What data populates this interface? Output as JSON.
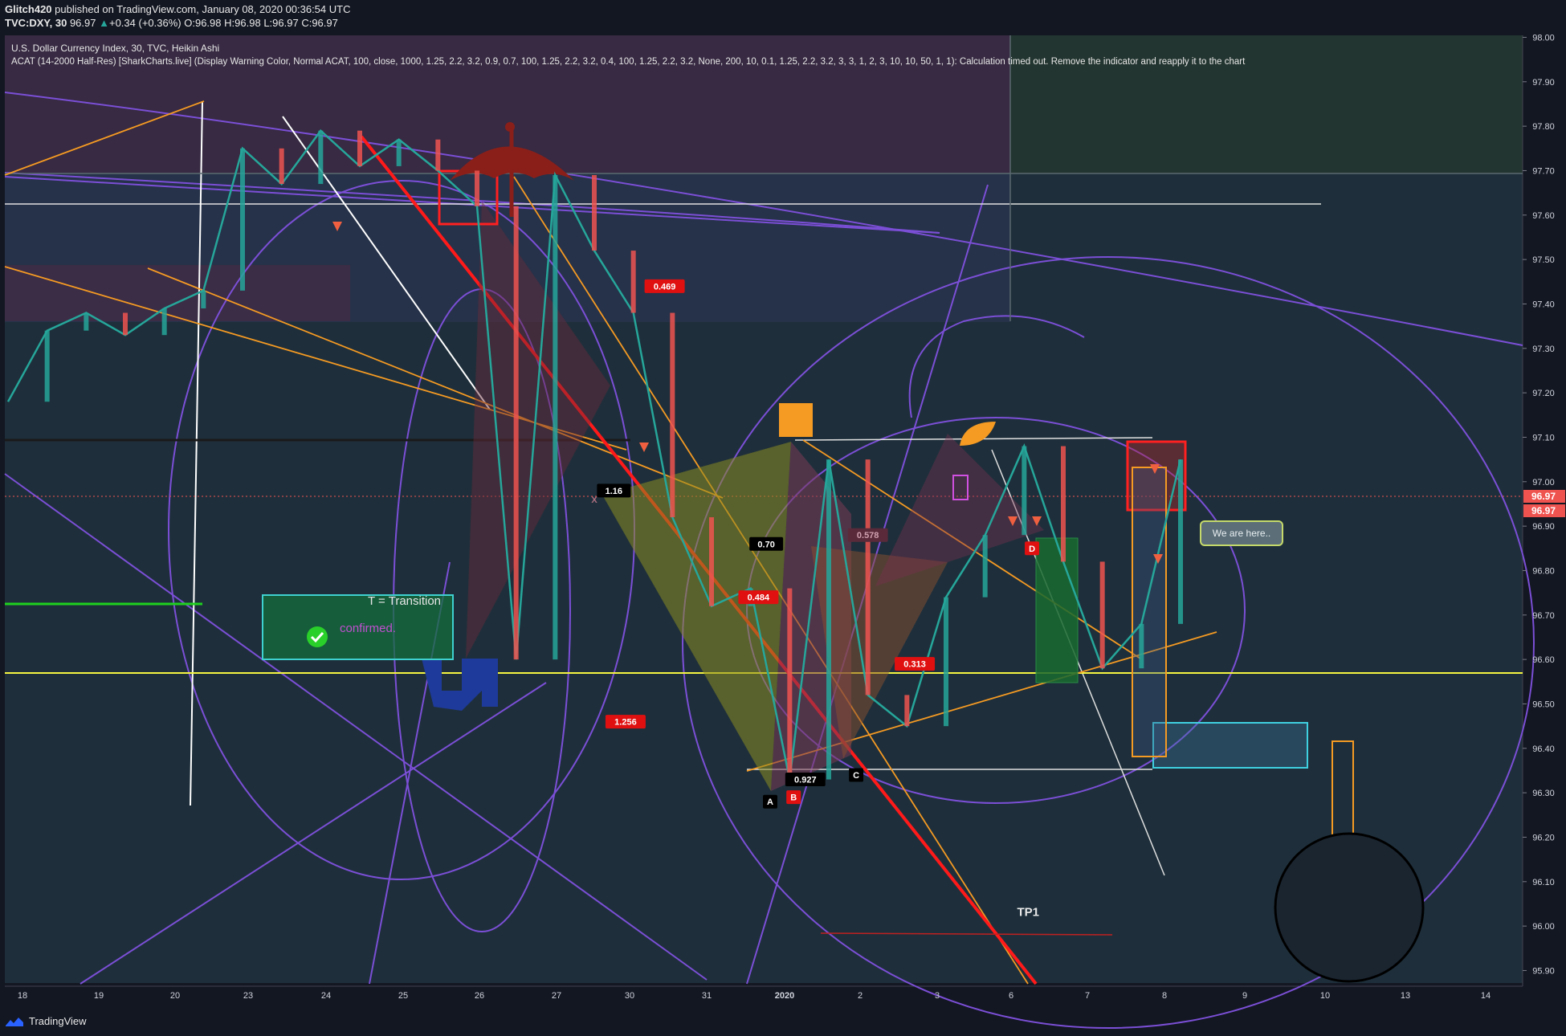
{
  "header": {
    "publisher": "Glitch420",
    "publish_text": " published on TradingView.com, January 08, 2020 00:36:54 UTC",
    "symbol": "TVC:DXY, 30",
    "last": "96.97",
    "change": "+0.34 (+0.36%)",
    "o_label": "O:",
    "o_value": "96.98",
    "h_label": "H:",
    "h_value": "96.98",
    "l_label": "L:",
    "l_value": "96.97",
    "c_label": "C:",
    "c_value": "96.97"
  },
  "legend": {
    "line1": "U.S. Dollar Currency Index, 30, TVC, Heikin Ashi",
    "line2": "ACAT (14-2000 Half-Res) [SharkCharts.live] (Display Warning Color, Normal ACAT, 100, close, 1000, 1.25, 2.2, 3.2, 0.9, 0.7, 100, 1.25, 2.2, 3.2, 0.4, 100, 1.25, 2.2, 3.2, None, 200, 10, 0.1, 1.25, 2.2, 3.2, 3, 3, 1, 2, 3, 10, 10, 50, 1, 1): Calculation timed out. Remove the indicator and reapply it to the chart"
  },
  "colors": {
    "background": "#131722",
    "candle_up": "#26a69a",
    "candle_down": "#ef5350",
    "price_tag": "#ef5350",
    "yellow_line": "#f5f541",
    "purple": "#7b4fd6",
    "orange": "#f59a23"
  },
  "chart_data": {
    "type": "line",
    "title": "U.S. Dollar Currency Index, 30, TVC, Heikin Ashi",
    "y_axis_labels": [
      "98.00",
      "97.90",
      "97.80",
      "97.70",
      "97.60",
      "97.50",
      "97.40",
      "97.30",
      "97.20",
      "97.10",
      "97.00",
      "96.90",
      "96.80",
      "96.70",
      "96.60",
      "96.50",
      "96.40",
      "96.30",
      "96.20",
      "96.10",
      "96.00",
      "95.90"
    ],
    "x_axis_labels": [
      "18",
      "19",
      "20",
      "23",
      "24",
      "25",
      "26",
      "27",
      "30",
      "31",
      "2020",
      "2",
      "3",
      "6",
      "7",
      "8",
      "9",
      "10",
      "13",
      "14"
    ],
    "ylim": [
      95.88,
      98.02
    ],
    "current_price_labels": [
      "96.97",
      "96.97"
    ],
    "series": [
      {
        "name": "DXY",
        "x": [
          0,
          0.5,
          1,
          1.5,
          2,
          2.5,
          3,
          3.5,
          4,
          4.5,
          5,
          5.5,
          6,
          6.5,
          7,
          7.5,
          8,
          8.5,
          9,
          9.5,
          10,
          10.5,
          11,
          11.5,
          12,
          12.5,
          13,
          13.5,
          14,
          14.5,
          15
        ],
        "values": [
          97.18,
          97.34,
          97.38,
          97.33,
          97.39,
          97.43,
          97.75,
          97.67,
          97.79,
          97.71,
          97.77,
          97.7,
          97.62,
          96.6,
          97.69,
          97.52,
          97.38,
          96.92,
          96.72,
          96.76,
          96.33,
          97.05,
          96.52,
          96.45,
          96.74,
          96.88,
          97.08,
          96.82,
          96.58,
          96.68,
          97.05
        ]
      }
    ],
    "annotations": [
      {
        "text": "1.16",
        "x": 7.75,
        "y": 96.98
      },
      {
        "text": "0.70",
        "x": 9.7,
        "y": 96.86
      },
      {
        "text": "0.578",
        "x": 11.0,
        "y": 96.88
      },
      {
        "text": "0.469",
        "x": 8.4,
        "y": 97.44
      },
      {
        "text": "0.484",
        "x": 9.6,
        "y": 96.74
      },
      {
        "text": "0.313",
        "x": 11.6,
        "y": 96.59
      },
      {
        "text": "1.256",
        "x": 7.9,
        "y": 96.46
      },
      {
        "text": "0.927",
        "x": 10.2,
        "y": 96.33
      },
      {
        "text": "X",
        "x": 7.5,
        "y": 96.96
      },
      {
        "text": "A",
        "x": 9.75,
        "y": 96.28
      },
      {
        "text": "B",
        "x": 10.05,
        "y": 96.29
      },
      {
        "text": "C",
        "x": 10.85,
        "y": 96.34
      },
      {
        "text": "D",
        "x": 13.1,
        "y": 96.85
      },
      {
        "text": "TP1",
        "x": 13.05,
        "y": 96.03
      },
      {
        "text": "We are here..",
        "x": 15.3,
        "y": 96.89
      },
      {
        "text": "T = Transition",
        "x": 5.0,
        "y": 96.74
      },
      {
        "text": "confirmed.",
        "x": 4.5,
        "y": 96.67
      }
    ]
  },
  "footer": {
    "brand": "TradingView"
  }
}
